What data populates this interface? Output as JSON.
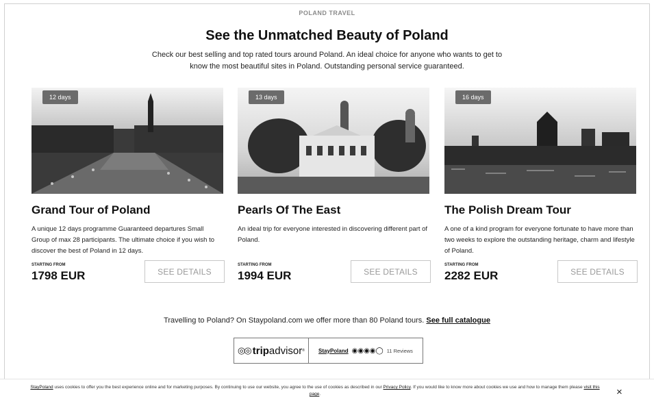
{
  "header": {
    "eyebrow": "POLAND TRAVEL",
    "title": "See the Unmatched Beauty of Poland",
    "intro": "Check our best selling and top rated tours around Poland. An ideal choice for anyone who wants to get to know the most beautiful sites in Poland. Outstanding personal service guaranteed."
  },
  "tours": [
    {
      "badge": "12 days",
      "title": "Grand Tour of Poland",
      "description": "A unique 12 days programme Guaranteed departures Small Group of max 28 participants. The ultimate choice if you wish to discover the best of Poland in 12 days.",
      "price_label": "STARTING FROM",
      "price": "1798 EUR",
      "button": "SEE DETAILS"
    },
    {
      "badge": "13 days",
      "title": "Pearls Of The East",
      "description": "An ideal trip for everyone interested in discovering different part of Poland.",
      "price_label": "STARTING FROM",
      "price": "1994 EUR",
      "button": "SEE DETAILS"
    },
    {
      "badge": "16 days",
      "title": "The Polish Dream Tour",
      "description": "A one of a kind program for everyone fortunate to have more than two weeks to explore the outstanding heritage, charm and lifestyle of Poland.",
      "price_label": "STARTING FROM",
      "price": "2282 EUR",
      "button": "SEE DETAILS"
    }
  ],
  "catalogue": {
    "text": "Travelling to Poland? On Staypoland.com we offer more than 80 Poland tours. ",
    "link": "See full catalogue"
  },
  "tripadvisor": {
    "logo_bold": "trip",
    "logo_rest": "advisor",
    "logo_mark": "®",
    "site": "StayPoland",
    "bubbles": "◉◉◉◉◯",
    "reviews": "11 Reviews"
  },
  "cookie": {
    "link_site": "StayPoland",
    "text_a": " uses cookies to offer you the best experience online and for marketing purposes. By continuing to use our website, you agree to the use of cookies as described in our ",
    "link_policy": "Privacy Policy",
    "text_b": ". If you would like to know more about cookies we use and how to manage them please ",
    "link_page": "visit this page",
    "text_c": ".",
    "close": "×"
  }
}
